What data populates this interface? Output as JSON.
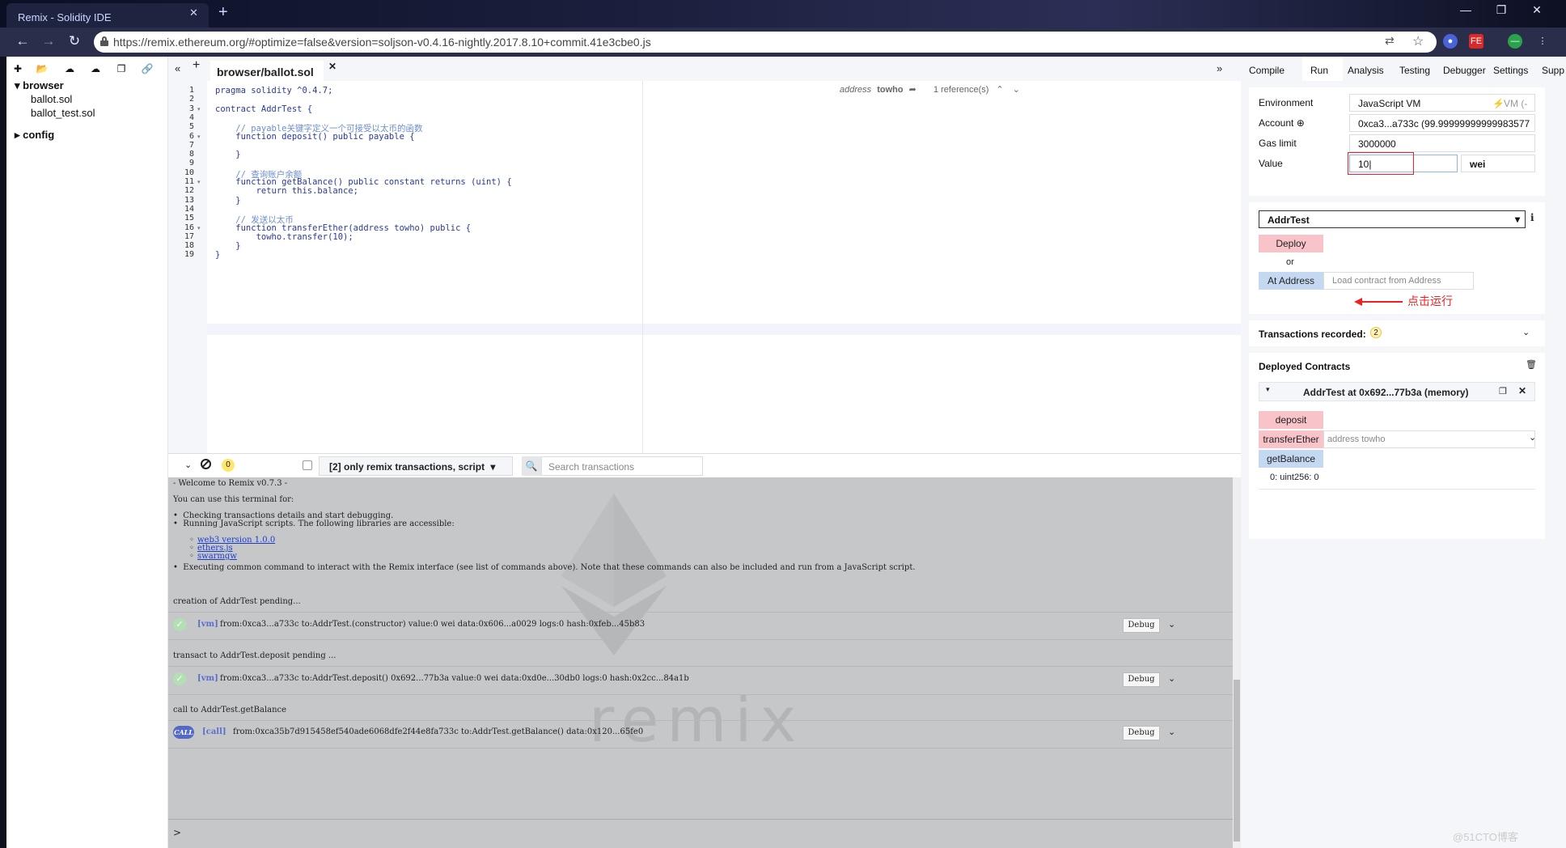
{
  "browser": {
    "tab_title": "Remix - Solidity IDE",
    "url": "https://remix.ethereum.org/#optimize=false&version=soljson-v0.4.16-nightly.2017.8.10+commit.41e3cbe0.js",
    "ext_fe_label": "FE"
  },
  "explorer": {
    "folders": [
      "browser",
      "config"
    ],
    "files": [
      "ballot.sol",
      "ballot_test.sol"
    ]
  },
  "editor": {
    "tab_name": "browser/ballot.sol",
    "info_address": "address",
    "info_name": "towho",
    "info_refs": "1 reference(s)",
    "lines": [
      "pragma solidity ^0.4.7;",
      "",
      "contract AddrTest {",
      "",
      "    // payable关键字定义一个可接受以太币的函数",
      "    function deposit() public payable {",
      "",
      "    }",
      "",
      "    // 查询账户余额",
      "    function getBalance() public constant returns (uint) {",
      "        return this.balance;",
      "    }",
      "",
      "    // 发送以太币",
      "    function transferEther(address towho) public {",
      "        towho.transfer(10);",
      "    }",
      "}"
    ]
  },
  "terminal_bar": {
    "pending_count": "0",
    "filter": "[2] only remix transactions, script",
    "search_placeholder": "Search transactions"
  },
  "terminal": {
    "welcome": "- Welcome to Remix v0.7.3 -",
    "use_for": "You can use this terminal for:",
    "bullet1": "Checking transactions details and start debugging.",
    "bullet2": "Running JavaScript scripts. The following libraries are accessible:",
    "libs": [
      "web3 version 1.0.0",
      "ethers.js",
      "swarmgw"
    ],
    "bullet3": "Executing common command to interact with the Remix interface (see list of commands above). Note that these commands can also be included and run from a JavaScript script.",
    "msg_creation": "creation of AddrTest pending...",
    "tx1_tag": "[vm]",
    "tx1": "from:0xca3...a733c to:AddrTest.(constructor) value:0 wei data:0x606...a0029 logs:0 hash:0xfeb...45b83",
    "msg_transact": "transact to AddrTest.deposit pending ...",
    "tx2_tag": "[vm]",
    "tx2": "from:0xca3...a733c to:AddrTest.deposit() 0x692...77b3a value:0 wei data:0xd0e...30db0 logs:0 hash:0x2cc...84a1b",
    "msg_call": "call to AddrTest.getBalance",
    "tx3_badge": "CALL",
    "tx3_tag": "[call]",
    "tx3": "from:0xca35b7d915458ef540ade6068dfe2f44e8fa733c to:AddrTest.getBalance() data:0x120...65fe0",
    "debug_label": "Debug",
    "watermark": "remix",
    "prompt": ">"
  },
  "right_tabs": [
    "Compile",
    "Run",
    "Analysis",
    "Testing",
    "Debugger",
    "Settings",
    "Supp"
  ],
  "run": {
    "environment_label": "Environment",
    "environment_value": "JavaScript VM",
    "environment_extra": "VM (-",
    "account_label": "Account",
    "account_value": "0xca3...a733c (99.99999999999983577",
    "gas_label": "Gas limit",
    "gas_value": "3000000",
    "value_label": "Value",
    "value_value": "10",
    "value_unit": "wei",
    "contract_select": "AddrTest",
    "deploy_label": "Deploy",
    "or_label": "or",
    "at_address_label": "At Address",
    "load_placeholder": "Load contract from Address",
    "tx_recorded_label": "Transactions recorded:",
    "tx_recorded_count": "2",
    "deployed_title": "Deployed Contracts",
    "instance_title": "AddrTest at 0x692...77b3a (memory)",
    "deposit_label": "deposit",
    "transfer_label": "transferEther",
    "transfer_placeholder": "address towho",
    "getbalance_label": "getBalance",
    "getbalance_result": "0: uint256: 0"
  },
  "annotation": {
    "text": "点击运行",
    "color": "#e22222"
  },
  "watermark_site": "@51CTO博客",
  "colors": {
    "accent_red_button": "#f9c4c9",
    "accent_blue_button": "#c5d8f1",
    "terminal_bg": "#c6c7c9"
  }
}
